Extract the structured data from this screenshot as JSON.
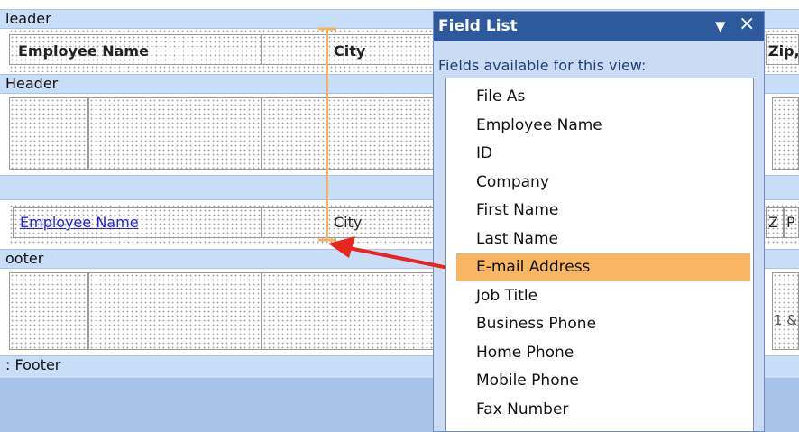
{
  "design": {
    "bands": {
      "page_header": "leader",
      "group_header": "Header",
      "group_footer": "ooter",
      "page_footer": ": Footer"
    },
    "header_labels": {
      "employee_name": "Employee Name",
      "city": "City",
      "zip_partial": "Zip,"
    },
    "detail_fields": {
      "employee_name": "Employee Name",
      "city": "City",
      "zip_partial": "Z",
      "partial_right": "P"
    },
    "footer_partial": "1 &"
  },
  "field_list": {
    "title": "Field List",
    "dropdown_glyph": "▼",
    "close_glyph": "×",
    "subtitle": "Fields available for this view:",
    "items": [
      {
        "label": "File As"
      },
      {
        "label": "Employee Name"
      },
      {
        "label": "ID"
      },
      {
        "label": "Company"
      },
      {
        "label": "First Name"
      },
      {
        "label": "Last Name"
      },
      {
        "label": "E-mail Address"
      },
      {
        "label": "Job Title"
      },
      {
        "label": "Business Phone"
      },
      {
        "label": "Home Phone"
      },
      {
        "label": "Mobile Phone"
      },
      {
        "label": "Fax Number"
      }
    ],
    "selected_index": 6
  },
  "colors": {
    "band_bg": "#c8ddf8",
    "panel_title_bg": "#2e5a9d",
    "selected_item": "#f9b662",
    "insertion_marker": "#f2b45c",
    "drag_arrow": "#e8261f",
    "hyperlink": "#1f1fe0"
  }
}
